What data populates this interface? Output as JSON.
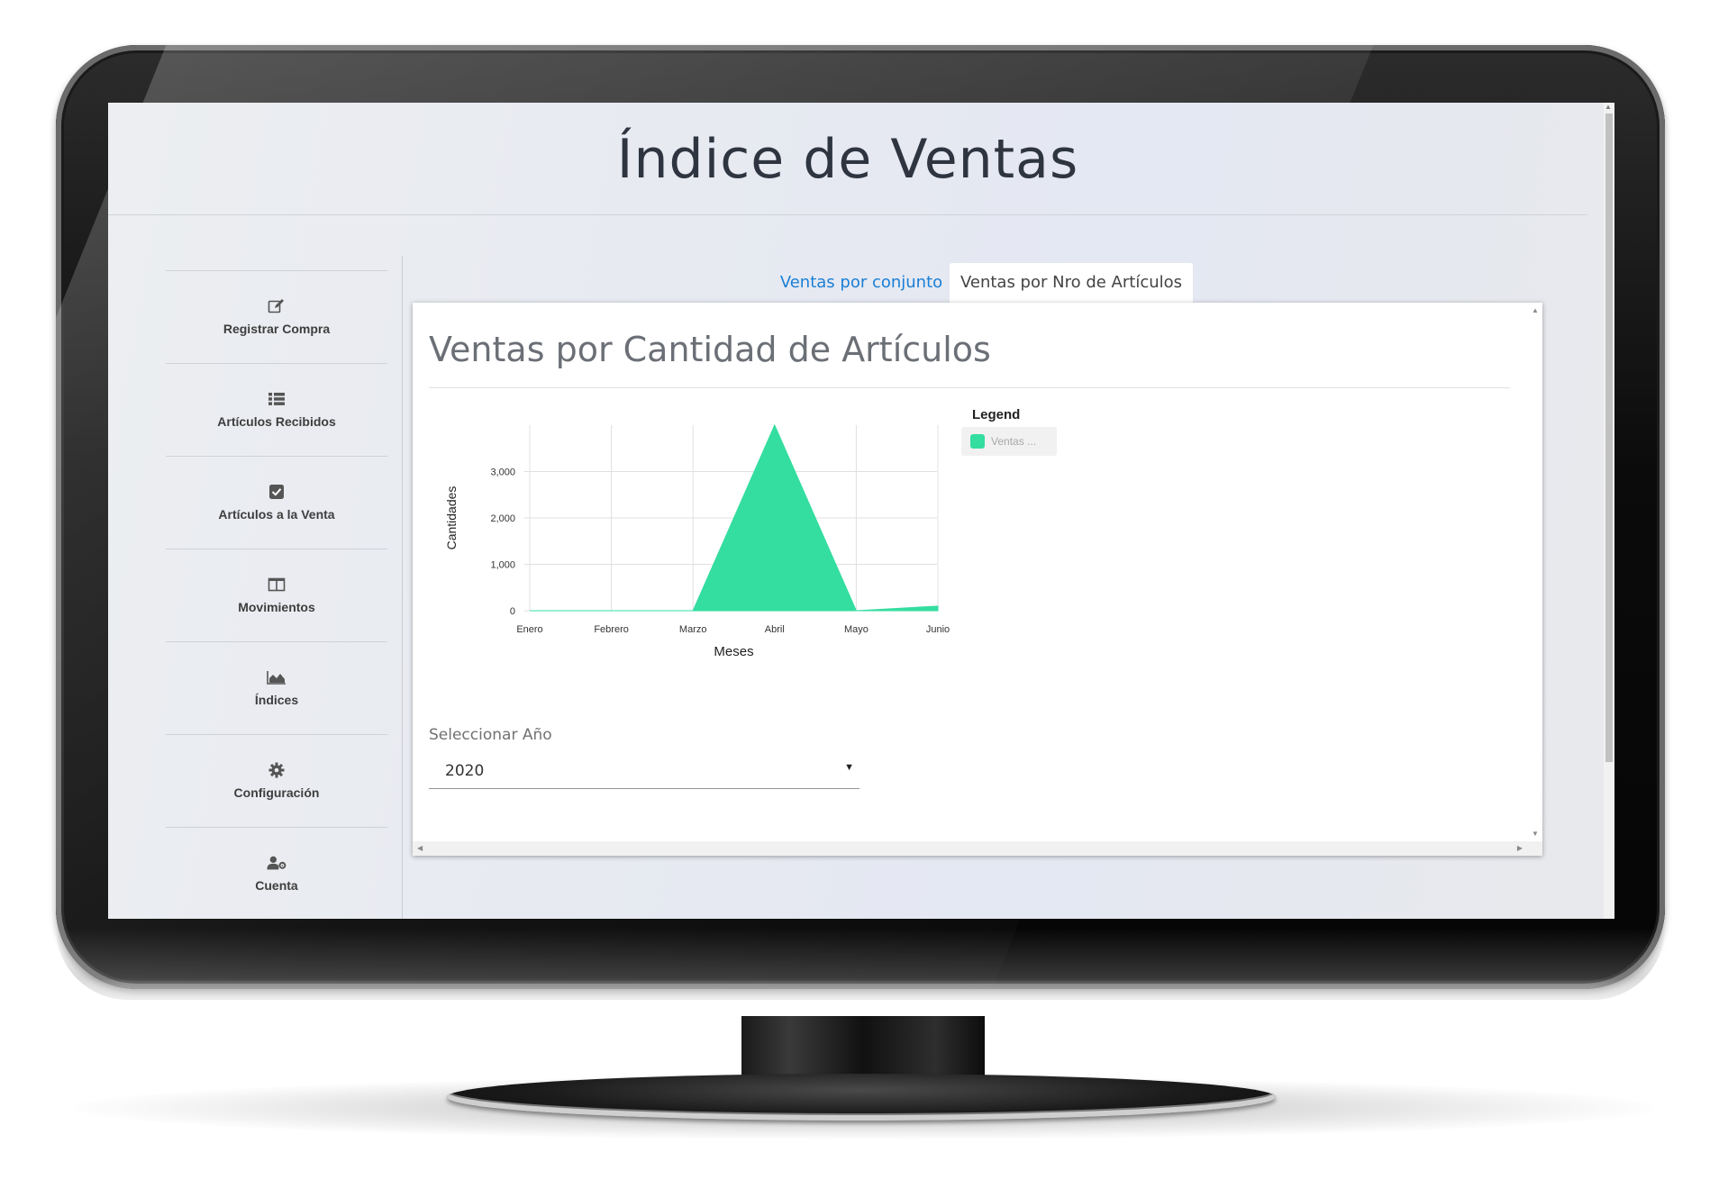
{
  "page": {
    "title": "Índice de Ventas"
  },
  "sidebar": {
    "items": [
      {
        "label": "Registrar Compra",
        "icon": "edit-icon"
      },
      {
        "label": "Artículos Recibidos",
        "icon": "list-icon"
      },
      {
        "label": "Artículos a la Venta",
        "icon": "check-square-icon"
      },
      {
        "label": "Movimientos",
        "icon": "columns-icon"
      },
      {
        "label": "Índices",
        "icon": "area-chart-icon"
      },
      {
        "label": "Configuración",
        "icon": "gear-icon"
      },
      {
        "label": "Cuenta",
        "icon": "user-cog-icon"
      }
    ]
  },
  "tabs": [
    {
      "label": "Ventas por conjunto",
      "active": false
    },
    {
      "label": "Ventas por Nro de Artículos",
      "active": true
    }
  ],
  "card": {
    "title": "Ventas por Cantidad de Artículos",
    "legend_title": "Legend",
    "legend_label": "Ventas ..."
  },
  "year_select": {
    "label": "Seleccionar Año",
    "value": "2020"
  },
  "colors": {
    "series": "#34dda0",
    "tab_link": "#1a7fd6"
  },
  "chart_data": {
    "type": "area",
    "categories": [
      "Enero",
      "Febrero",
      "Marzo",
      "Abril",
      "Mayo",
      "Junio"
    ],
    "series": [
      {
        "name": "Ventas ...",
        "values": [
          0,
          0,
          0,
          4000,
          0,
          100
        ]
      }
    ],
    "xlabel": "Meses",
    "ylabel": "Cantidades",
    "yticks": [
      "0",
      "1,000",
      "2,000",
      "3,000"
    ],
    "ylim": [
      0,
      4000
    ],
    "grid": true,
    "legend": "right"
  }
}
